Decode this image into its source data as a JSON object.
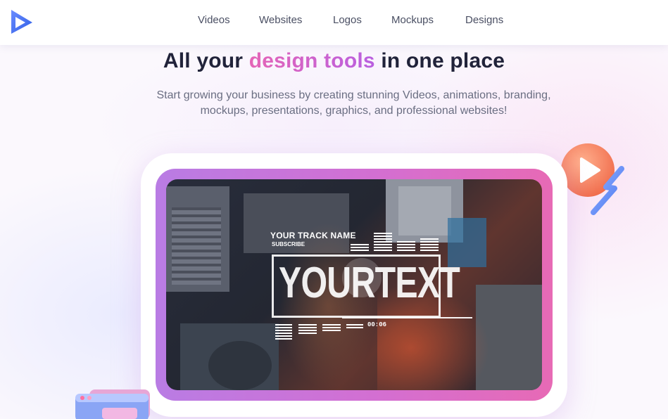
{
  "header": {
    "nav": [
      {
        "label": "Videos"
      },
      {
        "label": "Websites"
      },
      {
        "label": "Logos"
      },
      {
        "label": "Mockups"
      },
      {
        "label": "Designs"
      }
    ]
  },
  "hero": {
    "headline_pre": "All your ",
    "headline_accent": "design tools",
    "headline_post": " in one place",
    "subtitle": "Start growing your business by creating stunning Videos, animations, branding, mockups, presentations, graphics, and professional websites!"
  },
  "video": {
    "track_name": "YOUR TRACK NAME",
    "subscribe": "SUBSCRIBE",
    "main_text": "YOURTEXT",
    "timestamp": "00:06"
  },
  "colors": {
    "accent_pink": "#e565b7",
    "accent_purple": "#b95fe0",
    "logo_blue": "#3d6ff0",
    "deco_orange": "#f47a55"
  },
  "icons": {
    "logo": "play-triangle-logo-icon",
    "deco_play": "play-circle-icon",
    "deco_window": "browser-window-icon"
  }
}
